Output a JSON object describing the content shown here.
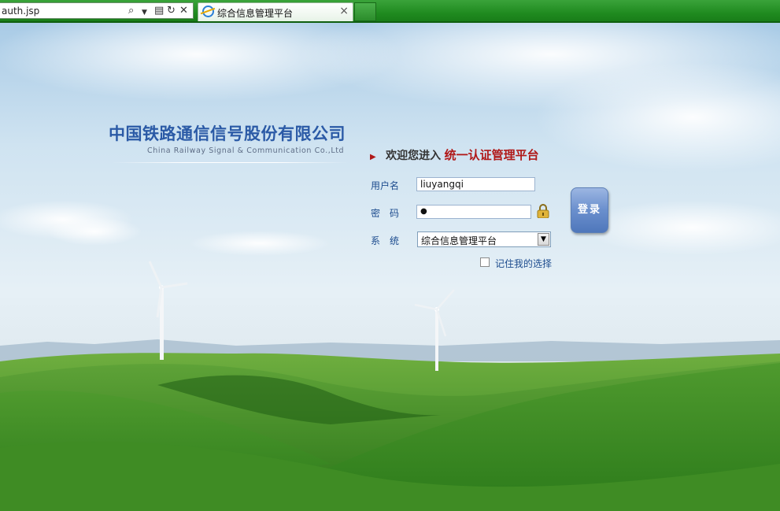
{
  "browser": {
    "address_text": "auth.jsp",
    "tab_title": "综合信息管理平台",
    "tab_close": "×"
  },
  "company": {
    "name_cn": "中国铁路通信信号股份有限公司",
    "name_en": "China Railway Signal & Communication Co.,Ltd"
  },
  "welcome": {
    "prefix": "欢迎您进入",
    "highlight": "统一认证管理平台"
  },
  "form": {
    "username_label": "用户名",
    "username_value": "liuyangqi",
    "password_label": "密　码",
    "password_mask": "●",
    "system_label": "系　统",
    "system_selected": "综合信息管理平台",
    "remember_label": "记住我的选择",
    "login_button": "登录"
  },
  "colors": {
    "brand_blue": "#2b5aa6",
    "accent_red": "#b01818",
    "tab_bar_green": "#1f8a1f"
  }
}
